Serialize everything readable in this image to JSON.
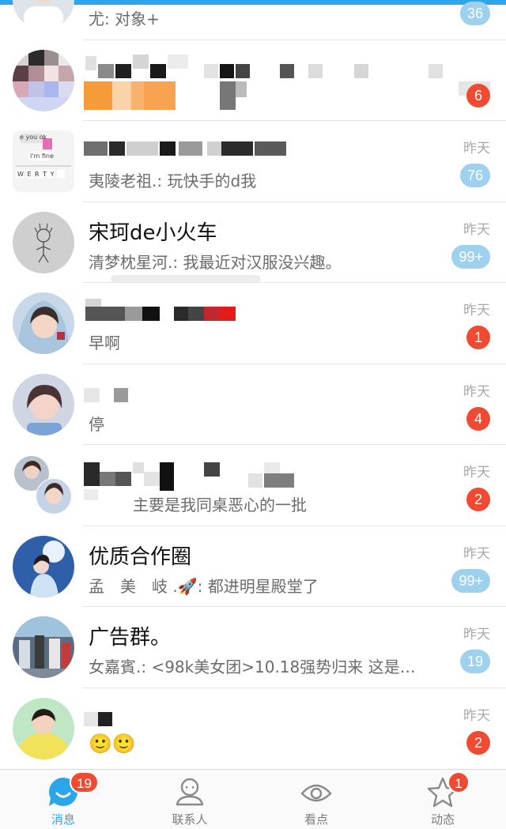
{
  "conversations": [
    {
      "name": "",
      "preview": "尤: 对象+",
      "time": "",
      "badge": "36",
      "badge_style": "muted"
    },
    {
      "name": "",
      "preview": "",
      "time": "",
      "badge": "6",
      "badge_style": "red"
    },
    {
      "name": "",
      "preview": "夷陵老祖.: 玩快手的d我",
      "time": "昨天",
      "badge": "76",
      "badge_style": "muted"
    },
    {
      "name": "宋珂de小火车",
      "preview": "清梦枕星河.: 我最近对汉服没兴趣。",
      "time": "昨天",
      "badge": "99+",
      "badge_style": "muted"
    },
    {
      "name": "",
      "preview": "早啊",
      "time": "昨天",
      "badge": "1",
      "badge_style": "red"
    },
    {
      "name": "",
      "preview": "停",
      "time": "昨天",
      "badge": "4",
      "badge_style": "red"
    },
    {
      "name": "",
      "preview": "主要是我同桌恶心的一批",
      "time": "昨天",
      "badge": "2",
      "badge_style": "red"
    },
    {
      "name": "优质合作圈",
      "preview": "孟　美　岐 .🚀: 都进明星殿堂了",
      "time": "昨天",
      "badge": "99+",
      "badge_style": "muted"
    },
    {
      "name": "广告群。",
      "preview": "女嘉賓.: <98k美女团>10.18强势归来 这是…",
      "time": "昨天",
      "badge": "19",
      "badge_style": "muted"
    },
    {
      "name": "",
      "preview": "🙂🙂",
      "time": "昨天",
      "badge": "2",
      "badge_style": "red"
    }
  ],
  "keyboard_thumb": {
    "line1": "e you ok",
    "line2": "I'm fine",
    "keys": "W E R T Y"
  },
  "tabs": [
    {
      "label": "消息",
      "badge": "19",
      "icon": "message-bubble-icon",
      "active": true
    },
    {
      "label": "联系人",
      "badge": "",
      "icon": "contact-person-icon",
      "active": false
    },
    {
      "label": "看点",
      "badge": "",
      "icon": "eye-icon",
      "active": false
    },
    {
      "label": "动态",
      "badge": "1",
      "icon": "star-icon",
      "active": false
    }
  ],
  "colors": {
    "accent": "#2ba6ea",
    "badge_red": "#f04a32",
    "badge_muted": "#9ed1ee"
  }
}
